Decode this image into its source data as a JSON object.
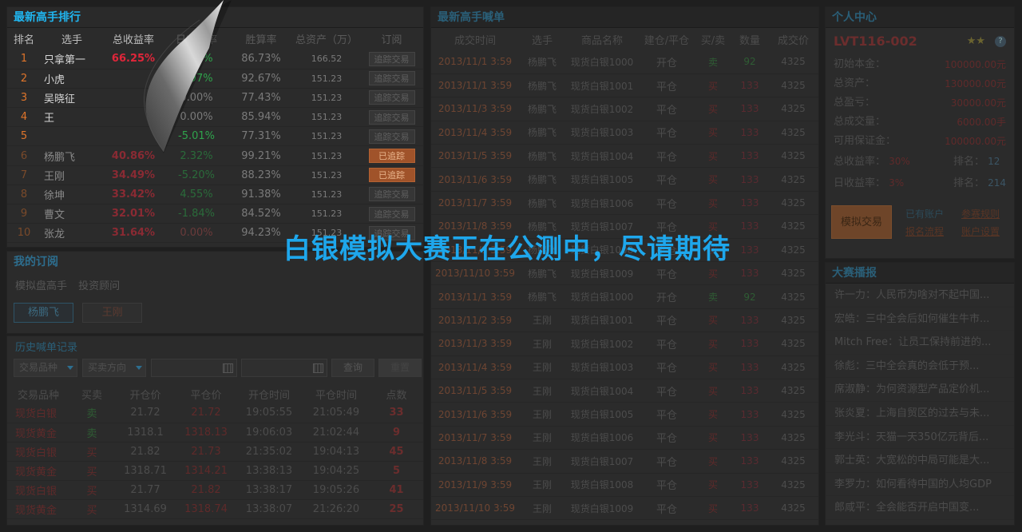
{
  "ranking": {
    "title": "最新高手排行",
    "headers": [
      "排名",
      "选手",
      "总收益率",
      "日收益率",
      "胜算率",
      "总资产（万）",
      "订阅"
    ],
    "rows": [
      {
        "rank": "1",
        "name": "只拿第一",
        "total": "66.25%",
        "daily": "2.89%",
        "win": "86.73%",
        "assets": "166.52",
        "action": "追踪交易",
        "followed": false
      },
      {
        "rank": "2",
        "name": "小虎",
        "total": "",
        "daily": "1.97%",
        "win": "92.67%",
        "assets": "151.23",
        "action": "追踪交易",
        "followed": false
      },
      {
        "rank": "3",
        "name": "吴晓征",
        "total": "",
        "daily": "0.00%",
        "win": "77.43%",
        "assets": "151.23",
        "action": "追踪交易",
        "followed": false
      },
      {
        "rank": "4",
        "name": "王",
        "total": "",
        "daily": "0.00%",
        "win": "85.94%",
        "assets": "151.23",
        "action": "追踪交易",
        "followed": false
      },
      {
        "rank": "5",
        "name": "",
        "total": "",
        "daily": "-5.01%",
        "win": "77.31%",
        "assets": "151.23",
        "action": "追踪交易",
        "followed": false
      },
      {
        "rank": "6",
        "name": "杨鹏飞",
        "total": "40.86%",
        "daily": "2.32%",
        "win": "99.21%",
        "assets": "151.23",
        "action": "已追踪",
        "followed": true
      },
      {
        "rank": "7",
        "name": "王刚",
        "total": "34.49%",
        "daily": "-5.20%",
        "win": "88.23%",
        "assets": "151.23",
        "action": "已追踪",
        "followed": true
      },
      {
        "rank": "8",
        "name": "徐坤",
        "total": "33.42%",
        "daily": "4.55%",
        "win": "91.38%",
        "assets": "151.23",
        "action": "追踪交易",
        "followed": false
      },
      {
        "rank": "9",
        "name": "曹文",
        "total": "32.01%",
        "daily": "-1.84%",
        "win": "84.52%",
        "assets": "151.23",
        "action": "追踪交易",
        "followed": false
      },
      {
        "rank": "10",
        "name": "张龙",
        "total": "31.64%",
        "daily": "0.00%",
        "win": "94.23%",
        "assets": "151.23",
        "action": "追踪交易",
        "followed": false
      }
    ]
  },
  "subs": {
    "title": "我的订阅",
    "tabs": [
      "模拟盘高手",
      "投资顾问"
    ],
    "chips": [
      "杨鹏飞",
      "王刚"
    ]
  },
  "history": {
    "title": "历史喊单记录",
    "select1": "交易品种",
    "select2": "买卖方向",
    "query": "查询",
    "reset": "重置",
    "headers": [
      "交易品种",
      "买卖",
      "开仓价",
      "平仓价",
      "开仓时间",
      "平仓时间",
      "点数"
    ],
    "rows": [
      {
        "item": "现货白银",
        "side": "卖",
        "open": "21.72",
        "close": "21.72",
        "otime": "19:05:55",
        "ctime": "21:05:49",
        "pts": "33"
      },
      {
        "item": "现货黄金",
        "side": "卖",
        "open": "1318.1",
        "close": "1318.13",
        "otime": "19:06:03",
        "ctime": "21:02:44",
        "pts": "9"
      },
      {
        "item": "现货白银",
        "side": "买",
        "open": "21.82",
        "close": "21.73",
        "otime": "21:35:02",
        "ctime": "19:04:13",
        "pts": "45"
      },
      {
        "item": "现货黄金",
        "side": "买",
        "open": "1318.71",
        "close": "1314.21",
        "otime": "13:38:13",
        "ctime": "19:04:25",
        "pts": "5"
      },
      {
        "item": "现货白银",
        "side": "买",
        "open": "21.77",
        "close": "21.82",
        "otime": "13:38:17",
        "ctime": "19:05:26",
        "pts": "41"
      },
      {
        "item": "现货黄金",
        "side": "买",
        "open": "1314.69",
        "close": "1318.74",
        "otime": "13:38:07",
        "ctime": "21:26:20",
        "pts": "25"
      }
    ]
  },
  "calls": {
    "title": "最新高手喊单",
    "headers": [
      "成交时间",
      "选手",
      "商品名称",
      "建仓/平仓",
      "买/卖",
      "数量",
      "成交价"
    ],
    "rows": [
      {
        "time": "2013/11/1 3:59",
        "player": "杨鹏飞",
        "product": "现货白银1000",
        "pos": "开仓",
        "side": "卖",
        "qty": "92",
        "price": "4325"
      },
      {
        "time": "2013/11/1 3:59",
        "player": "杨鹏飞",
        "product": "现货白银1001",
        "pos": "平仓",
        "side": "买",
        "qty": "133",
        "price": "4325"
      },
      {
        "time": "2013/11/3 3:59",
        "player": "杨鹏飞",
        "product": "现货白银1002",
        "pos": "平仓",
        "side": "买",
        "qty": "133",
        "price": "4325"
      },
      {
        "time": "2013/11/4 3:59",
        "player": "杨鹏飞",
        "product": "现货白银1003",
        "pos": "平仓",
        "side": "买",
        "qty": "133",
        "price": "4325"
      },
      {
        "time": "2013/11/5 3:59",
        "player": "杨鹏飞",
        "product": "现货白银1004",
        "pos": "平仓",
        "side": "买",
        "qty": "133",
        "price": "4325"
      },
      {
        "time": "2013/11/6 3:59",
        "player": "杨鹏飞",
        "product": "现货白银1005",
        "pos": "平仓",
        "side": "买",
        "qty": "133",
        "price": "4325"
      },
      {
        "time": "2013/11/7 3:59",
        "player": "杨鹏飞",
        "product": "现货白银1006",
        "pos": "平仓",
        "side": "买",
        "qty": "133",
        "price": "4325"
      },
      {
        "time": "2013/11/8 3:59",
        "player": "杨鹏飞",
        "product": "现货白银1007",
        "pos": "平仓",
        "side": "买",
        "qty": "133",
        "price": "4325"
      },
      {
        "time": "2013/11/9 3:59",
        "player": "杨鹏飞",
        "product": "现货白银1008",
        "pos": "平仓",
        "side": "买",
        "qty": "133",
        "price": "4325"
      },
      {
        "time": "2013/11/10 3:59",
        "player": "杨鹏飞",
        "product": "现货白银1009",
        "pos": "平仓",
        "side": "买",
        "qty": "133",
        "price": "4325"
      },
      {
        "time": "2013/11/1 3:59",
        "player": "杨鹏飞",
        "product": "现货白银1000",
        "pos": "开仓",
        "side": "卖",
        "qty": "92",
        "price": "4325"
      },
      {
        "time": "2013/11/2 3:59",
        "player": "王刚",
        "product": "现货白银1001",
        "pos": "平仓",
        "side": "买",
        "qty": "133",
        "price": "4325"
      },
      {
        "time": "2013/11/3 3:59",
        "player": "王刚",
        "product": "现货白银1002",
        "pos": "平仓",
        "side": "买",
        "qty": "133",
        "price": "4325"
      },
      {
        "time": "2013/11/4 3:59",
        "player": "王刚",
        "product": "现货白银1003",
        "pos": "平仓",
        "side": "买",
        "qty": "133",
        "price": "4325"
      },
      {
        "time": "2013/11/5 3:59",
        "player": "王刚",
        "product": "现货白银1004",
        "pos": "平仓",
        "side": "买",
        "qty": "133",
        "price": "4325"
      },
      {
        "time": "2013/11/6 3:59",
        "player": "王刚",
        "product": "现货白银1005",
        "pos": "平仓",
        "side": "买",
        "qty": "133",
        "price": "4325"
      },
      {
        "time": "2013/11/7 3:59",
        "player": "王刚",
        "product": "现货白银1006",
        "pos": "平仓",
        "side": "买",
        "qty": "133",
        "price": "4325"
      },
      {
        "time": "2013/11/8 3:59",
        "player": "王刚",
        "product": "现货白银1007",
        "pos": "平仓",
        "side": "买",
        "qty": "133",
        "price": "4325"
      },
      {
        "time": "2013/11/9 3:59",
        "player": "王刚",
        "product": "现货白银1008",
        "pos": "平仓",
        "side": "买",
        "qty": "133",
        "price": "4325"
      },
      {
        "time": "2013/11/10 3:59",
        "player": "王刚",
        "product": "现货白银1009",
        "pos": "平仓",
        "side": "买",
        "qty": "133",
        "price": "4325"
      }
    ]
  },
  "personal": {
    "title": "个人中心",
    "account": "LVT116-002",
    "stars": "★★",
    "help": "?",
    "fields": [
      {
        "label": "初始本金：",
        "value": "100000.00元"
      },
      {
        "label": "总资产：",
        "value": "130000.00元"
      },
      {
        "label": "总盈亏：",
        "value": "30000.00元"
      },
      {
        "label": "总成交量：",
        "value": "6000.00手"
      },
      {
        "label": "可用保证金：",
        "value": "100000.00元"
      }
    ],
    "total_return_label": "总收益率：",
    "total_return": "30%",
    "rank1_label": "排名：",
    "rank1": "12",
    "daily_return_label": "日收益率：",
    "daily_return": "3%",
    "rank2_label": "排名：",
    "rank2": "214",
    "sim_button": "模拟交易",
    "links": [
      "已有账户",
      "参赛规则",
      "报名流程",
      "账户设置"
    ]
  },
  "news": {
    "title": "大赛播报",
    "items": [
      "许一力：人民币为啥对不起中国...",
      "宏皓：三中全会后如何催生牛市...",
      "Mitch Free：让员工保持前进的...",
      "徐彪：三中全会真的会低于预...",
      "席淑静：为何资源型产品定价机...",
      "张炎夏：上海自贸区的过去与未...",
      "李光斗：天猫一天350亿元背后...",
      "郭士英：大宽松的中局可能是大...",
      "李罗力：如何看待中国的人均GDP",
      "郎咸平：全会能否开启中国变..."
    ]
  },
  "banner": "白银模拟大赛正在公测中，尽请期待"
}
